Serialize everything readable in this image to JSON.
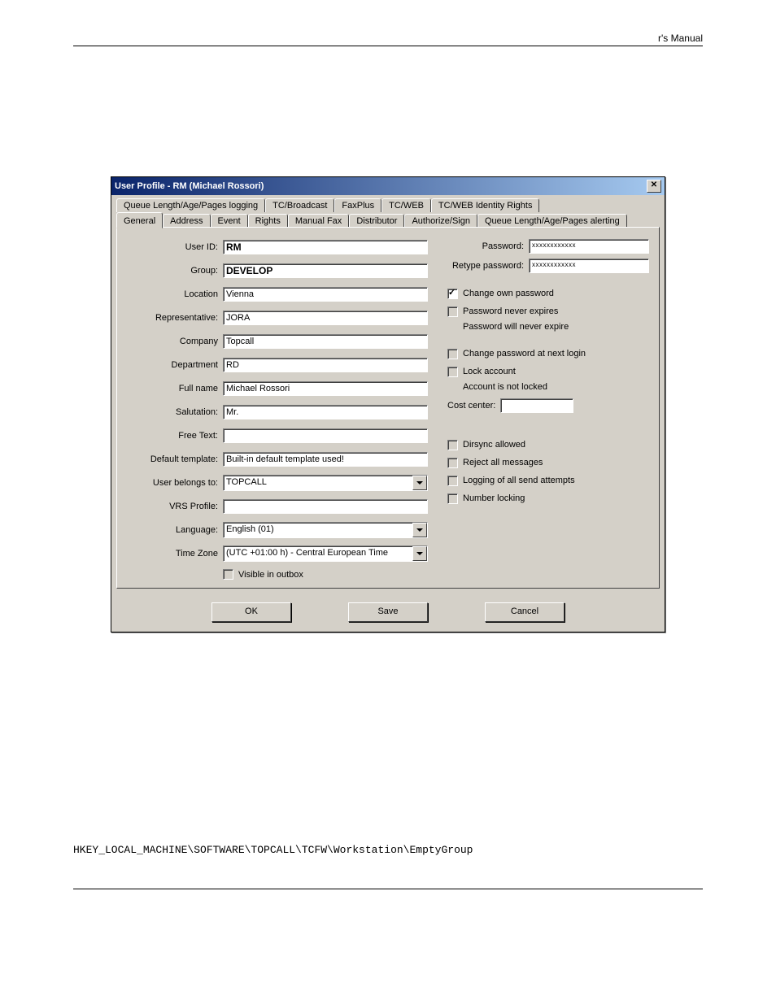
{
  "doc": {
    "header_text": "r's Manual",
    "registry_path": "HKEY_LOCAL_MACHINE\\SOFTWARE\\TOPCALL\\TCFW\\Workstation\\EmptyGroup"
  },
  "dialog": {
    "title": "User Profile - RM (Michael Rossori)",
    "tabs_back": [
      "Queue Length/Age/Pages logging",
      "TC/Broadcast",
      "FaxPlus",
      "TC/WEB",
      "TC/WEB Identity Rights"
    ],
    "tabs_front": [
      "General",
      "Address",
      "Event",
      "Rights",
      "Manual Fax",
      "Distributor",
      "Authorize/Sign",
      "Queue Length/Age/Pages alerting"
    ],
    "active_tab": "General"
  },
  "left": {
    "user_id_label": "User ID:",
    "user_id": "RM",
    "group_label": "Group:",
    "group": "DEVELOP",
    "location_label": "Location",
    "location": "Vienna",
    "representative_label": "Representative:",
    "representative": "JORA",
    "company_label": "Company",
    "company": "Topcall",
    "department_label": "Department",
    "department": "RD",
    "full_name_label": "Full name",
    "full_name": "Michael Rossori",
    "salutation_label": "Salutation:",
    "salutation": "Mr.",
    "free_text_label": "Free Text:",
    "free_text": "",
    "default_template_label": "Default template:",
    "default_template": "Built-in default template used!",
    "user_belongs_label": "User belongs to:",
    "user_belongs": "TOPCALL",
    "vrs_profile_label": "VRS Profile:",
    "vrs_profile": "",
    "language_label": "Language:",
    "language": "English (01)",
    "time_zone_label": "Time Zone",
    "time_zone": "(UTC +01:00 h) - Central European Time",
    "visible_label": "Visible in outbox"
  },
  "right": {
    "password_label": "Password:",
    "password": "xxxxxxxxxxxx",
    "retype_label": "Retype password:",
    "retype": "xxxxxxxxxxxx",
    "change_own": "Change own password",
    "never_expires": "Password never expires",
    "never_expire_note": "Password will never expire",
    "change_next": "Change password at next login",
    "lock_account": "Lock account",
    "not_locked_note": "Account is not locked",
    "cost_center_label": "Cost center:",
    "dirsync": "Dirsync allowed",
    "reject_all": "Reject all messages",
    "logging_all": "Logging of all send attempts",
    "number_locking": "Number locking"
  },
  "buttons": {
    "ok": "OK",
    "save": "Save",
    "cancel": "Cancel"
  }
}
